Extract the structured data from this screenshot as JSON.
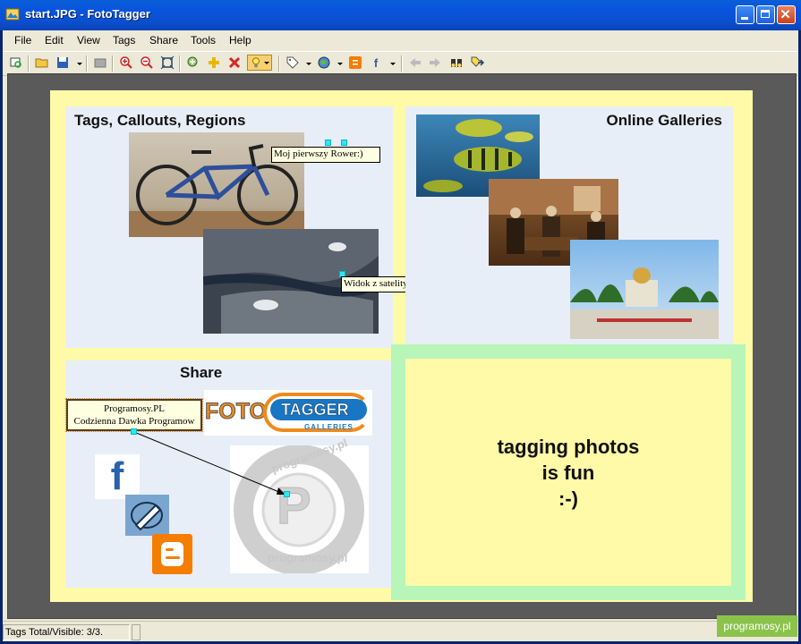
{
  "window": {
    "title": "start.JPG - FotoTagger"
  },
  "menu": {
    "items": [
      "File",
      "Edit",
      "View",
      "Tags",
      "Share",
      "Tools",
      "Help"
    ]
  },
  "toolbar": {
    "buttons": [
      "open-file-icon",
      "open-folder-icon",
      "save-icon",
      "delete-file-icon",
      "zoom-in-icon",
      "zoom-out-icon",
      "fit-window-icon",
      "add-tag-icon",
      "add-icon",
      "delete-icon",
      "bulb-icon",
      "tag-icon",
      "globe-icon",
      "blogger-icon",
      "facebook-icon",
      "back-arrow-icon",
      "forward-arrow-icon",
      "binoculars-icon",
      "tag-arrow-icon"
    ]
  },
  "canvas": {
    "panels": {
      "tags": {
        "title": "Tags, Callouts, Regions"
      },
      "galleries": {
        "title": "Online Galleries"
      },
      "share": {
        "title": "Share"
      }
    },
    "callouts": {
      "bike": "Moj pierwszy Rower:)",
      "satellite": "Widok z satelity",
      "programosy_line1": "Programosy.PL",
      "programosy_line2": "Codzienna Dawka Programow"
    },
    "fototagger_logo": {
      "left": "FOTO",
      "right": "TAGGER",
      "sub": "GALLERIES"
    },
    "programosy_logo": {
      "letter": "P",
      "ring": "programosy.pl"
    },
    "fun_text": {
      "line1": "tagging photos",
      "line2": "is fun",
      "line3": ":-)"
    }
  },
  "statusbar": {
    "text": "Tags Total/Visible: 3/3."
  },
  "watermark": {
    "text": "programosy.pl"
  },
  "colors": {
    "title_bar": "#0a5fd8",
    "canvas_bg": "#fffaa8",
    "panel_bg": "#e8eef7",
    "fun_border": "#b8f5b8",
    "handle": "#2ee6f0"
  }
}
